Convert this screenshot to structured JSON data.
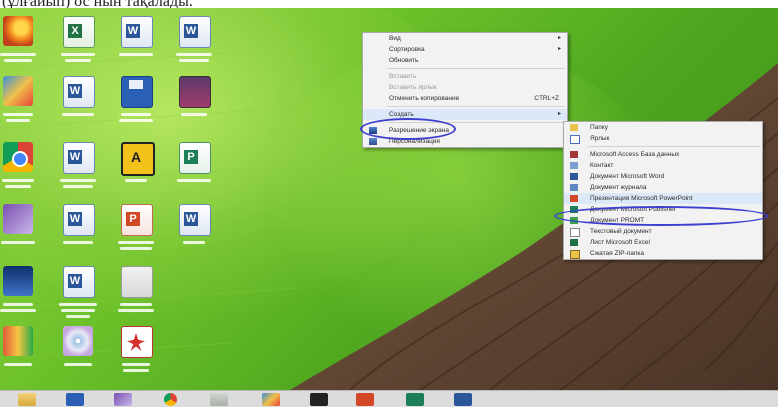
{
  "caption": "(ұлғайып) ос нын тақалады.",
  "context_menu": {
    "items": [
      {
        "label": "Вид",
        "arrow": "▸"
      },
      {
        "label": "Сортировка",
        "arrow": "▸"
      },
      {
        "label": "Обновить"
      },
      {
        "label": "Вставить",
        "disabled": true
      },
      {
        "label": "Вставить ярлык",
        "disabled": true
      },
      {
        "label": "Отменить копирование",
        "shortcut": "CTRL+Z"
      },
      {
        "label": "Создать",
        "arrow": "▸"
      },
      {
        "label": "Разрешение экрана"
      },
      {
        "label": "Персонализация"
      }
    ]
  },
  "submenu": {
    "items": [
      {
        "label": "Папку"
      },
      {
        "label": "Ярлык"
      },
      {
        "label": "Microsoft Access База данных"
      },
      {
        "label": "Контакт"
      },
      {
        "label": "Документ Microsoft Word"
      },
      {
        "label": "Документ журнала"
      },
      {
        "label": "Презентация Microsoft PowerPoint"
      },
      {
        "label": "Документ Microsoft Publisher"
      },
      {
        "label": "Документ PROMT"
      },
      {
        "label": "Текстовый документ"
      },
      {
        "label": "Лист Microsoft Excel"
      },
      {
        "label": "Сжатая ZIP-папка"
      }
    ]
  },
  "colors": {
    "circle": "#3c3fd0",
    "menu_bg": "#f2f2f2",
    "highlight": "#dbe8f7"
  },
  "desktop_icons": [
    "firefox-icon",
    "excel-icon",
    "word-icon",
    "word-icon",
    "paint-icon",
    "word-icon",
    "save-icon",
    "photo-icon",
    "chrome-icon",
    "word-icon",
    "aimp-icon",
    "publisher-icon",
    "visual-studio-icon",
    "word-icon",
    "powerpoint-icon",
    "word-icon",
    "calculator-icon",
    "word-icon",
    "gift-icon",
    "flag-icon",
    "disc-icon",
    "pdf-icon"
  ],
  "taskbar_icons": [
    "folder-icon",
    "save-icon",
    "visual-studio-icon",
    "chrome-icon",
    "paint-icon",
    "film-icon",
    "powerpoint-icon",
    "publisher-icon",
    "word-icon"
  ]
}
